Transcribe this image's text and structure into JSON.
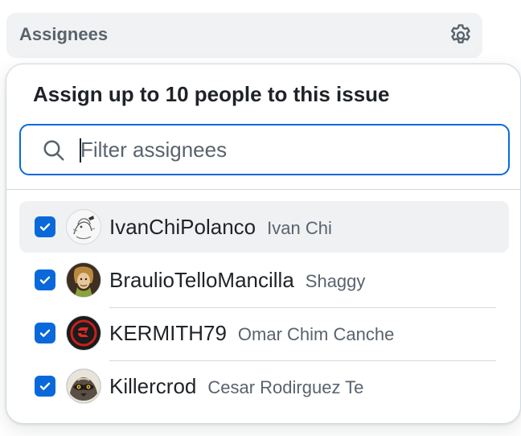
{
  "sidebar": {
    "title": "Assignees",
    "settings_icon": "gear-icon"
  },
  "popover": {
    "title": "Assign up to 10 people to this issue",
    "filter": {
      "placeholder": "Filter assignees",
      "value": "",
      "icon": "search-icon"
    },
    "assignees": [
      {
        "login": "IvanChiPolanco",
        "name": "Ivan Chi",
        "checked": true,
        "avatar_icon": "avatar-sketch-icon"
      },
      {
        "login": "BraulioTelloMancilla",
        "name": "Shaggy",
        "checked": true,
        "avatar_icon": "avatar-cartoon-icon"
      },
      {
        "login": "KERMITH79",
        "name": "Omar Chim Canche",
        "checked": true,
        "avatar_icon": "avatar-red-logo-icon"
      },
      {
        "login": "Killercrod",
        "name": "Cesar Rodirguez Te",
        "checked": true,
        "avatar_icon": "avatar-raccoon-icon"
      }
    ]
  },
  "colors": {
    "accent": "#0969da",
    "header_bg": "#f1f2f4",
    "muted_text": "#59636e",
    "row_hover": "#f0f1f3"
  }
}
